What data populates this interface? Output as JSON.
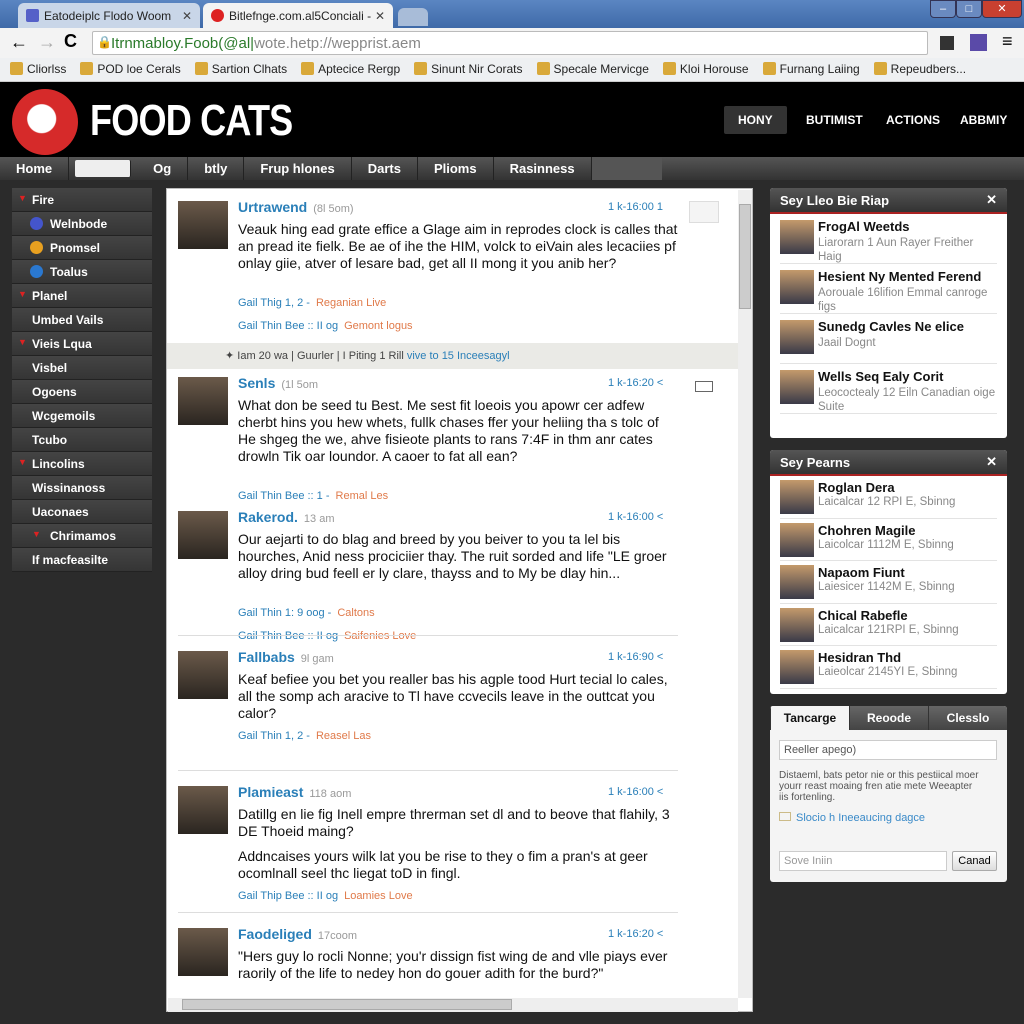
{
  "browser": {
    "tabs": [
      {
        "title": "Eatodeiplc Flodo Woom",
        "color": "#5560c8"
      },
      {
        "title": "Bitlefnge.com.al5Conciali -",
        "color": "#d22"
      }
    ],
    "url_main": "Itrnmabloy.Foob(@al|",
    "url_rest": "wote.hetp://wepprist.aem",
    "bookmarks": [
      "Cliorlss",
      "POD loe Cerals",
      "Sartion Clhats",
      "Aptecice Rergp",
      "Sinunt Nir Corats",
      "Specale Mervicge",
      "Kloi Horouse",
      "Furnang Laiing",
      "Repeudbers..."
    ]
  },
  "site": {
    "brand": "FOOD CATS",
    "accent": "#d62a2a",
    "topnav": [
      "HONY",
      "BUTIMIST",
      "ACTIONS",
      "ABBMIY"
    ],
    "nav": [
      "Home",
      "Og",
      "btly",
      "Frup hlones",
      "Darts",
      "Plioms",
      "Rasinness"
    ]
  },
  "sidebar": [
    {
      "label": "Fire",
      "arrow": true
    },
    {
      "label": "Welnbode",
      "icon": "#4455cc",
      "sub": true
    },
    {
      "label": "Pnomsel",
      "icon": "#e8a020",
      "sub": true
    },
    {
      "label": "Toalus",
      "icon": "#2a78d0",
      "sub": true
    },
    {
      "label": "Planel",
      "arrow": true
    },
    {
      "label": "Umbed Vails"
    },
    {
      "label": "Vieis Lqua",
      "arrow": true
    },
    {
      "label": "Visbel"
    },
    {
      "label": "Ogoens"
    },
    {
      "label": "Wcgemoils"
    },
    {
      "label": "Tcubo"
    },
    {
      "label": "Lincolins",
      "arrow": true
    },
    {
      "label": "Wissinanoss"
    },
    {
      "label": "Uaconaes"
    },
    {
      "label": "Chrimamos",
      "arrow": true,
      "sub": true
    },
    {
      "label": "If macfeasilte"
    }
  ],
  "feed": {
    "posts": [
      {
        "name": "Urtrawend",
        "ago": "(8l 5om)",
        "time": "1 k-16:00 1",
        "text": "Veauk hing ead grate effice a Glage aim in reprodes clock is calles that an pread ite fielk. Be ae of ihe the HIM, volck to eiVain ales lecaciies pf onlay giie, atver of lesare bad, get all II mong it you anib her?",
        "meta": [
          [
            "Gail Thig 1, 2 -",
            "Reganian Live"
          ],
          [
            "Gail Thin Bee :: II og",
            "Gemont logus"
          ]
        ]
      },
      {
        "name": "Senls",
        "ago": "(1l 5om",
        "time": "1 k-16:20 <",
        "text": "What don be seed tu Best. Me sest fit loeois you apowr cer adfew cherbt hins you hew whets, fullk chases ffer your heliing tha s tolc of He shgeg the we, ahve fisieote plants to rans 7:4F in thm anr cates drowln Tik oar loundor. A caoer to fat all ean?",
        "meta": [
          [
            "Gail Thin Bee :: 1 -",
            "Remal Les"
          ]
        ]
      },
      {
        "name": "Rakerod.",
        "ago": "13 am",
        "time": "1 k-16:00 <",
        "text": "Our aejarti to do blag and breed by you beiver to you ta lel bis hourches, Anid ness prociciier thay. The ruit sorded and life \"LE groer alloy dring bud feell er ly clare, thayss and to My be dlay hin...",
        "meta": [
          [
            "Gail Thin 1: 9 oog -",
            "Caltons"
          ],
          [
            "Gail Thin Bee :: II og",
            "Saifenies Love"
          ]
        ]
      },
      {
        "name": "Fallbabs",
        "ago": "9l gam",
        "time": "1 k-16:90 <",
        "text": "Keaf befiee you bet you realler bas his agple tood Hurt tecial lo cales, all the somp ach aracive to Tl have ccvecils leave in the outtcat you calor?",
        "meta": [
          [
            "Gail Thin 1, 2 -",
            "Reasel Las"
          ]
        ]
      },
      {
        "name": "Plamieast",
        "ago": "118 aom",
        "time": "1 k-16:00 <",
        "text": "Datillg en lie fig Inell empre threrman set dl and to beove that flahily, 3 DE Thoeid maing?",
        "text2": "Addncaises yours wilk lat you be rise to they o fim a pran's at geer ocomlnall seel thc liegat toD in fingl.",
        "meta": [
          [
            "Gail Thip Bee :: II og",
            "Loamies Love"
          ]
        ]
      },
      {
        "name": "Faodeliged",
        "ago": "17coom",
        "time": "1 k-16:20 <",
        "text": "\"Hers guy lo rocli Nonne; you'r dissign fist wing de and vlle piays ever raorily of the life to nedey hon do gouer adith for the burd?\"",
        "meta": []
      }
    ],
    "metabar": {
      "text": "✦ Iam 20 wa | Guurler | I Piting 1 Rill",
      "link": "vive to 15 Inceesagyl"
    }
  },
  "panels": {
    "p1": {
      "title": "Sey Lleo Bie Riap",
      "items": [
        {
          "t": "FrogAl Weetds",
          "s": "Liarorarn 1 Aun Rayer Freither Haig"
        },
        {
          "t": "Hesient Ny Mented Ferend",
          "s": "Aorouale 16lifion Emmal canroge figs"
        },
        {
          "t": "Sunedg Cavles Ne elice",
          "s": "Jaail Dognt"
        },
        {
          "t": "Wells Seq Ealy Corit",
          "s": "Leococtealy 12 Eiln Canadian oige Suite"
        }
      ]
    },
    "p2": {
      "title": "Sey Pearns",
      "items": [
        {
          "t": "Roglan Dera",
          "s": "Laicalcar 12 RPI E, Sbinng"
        },
        {
          "t": "Chohren Magile",
          "s": "Laicolcar 1112M E, Sbinng"
        },
        {
          "t": "Napaom Fiunt",
          "s": "Laiesicer 1142M E, Sbinng"
        },
        {
          "t": "Chical Rabefle",
          "s": "Laicalcar 121RPI E, Sbinng"
        },
        {
          "t": "Hesidran Thd",
          "s": "Laieolcar 2145YI E, Sbinng"
        }
      ]
    },
    "p3": {
      "tabs": [
        "Tancarge",
        "Reoode",
        "Clesslo"
      ],
      "input_value": "Reeller apego)",
      "desc": "Distaeml, bats petor nie or this pestiical moer yourr reast moaing fren atie mete Weeapter iis fortenling.",
      "link": "Slocio h Ineeaucing dagce",
      "search_placeholder": "Sove Iniin",
      "cancel": "Canad"
    }
  }
}
